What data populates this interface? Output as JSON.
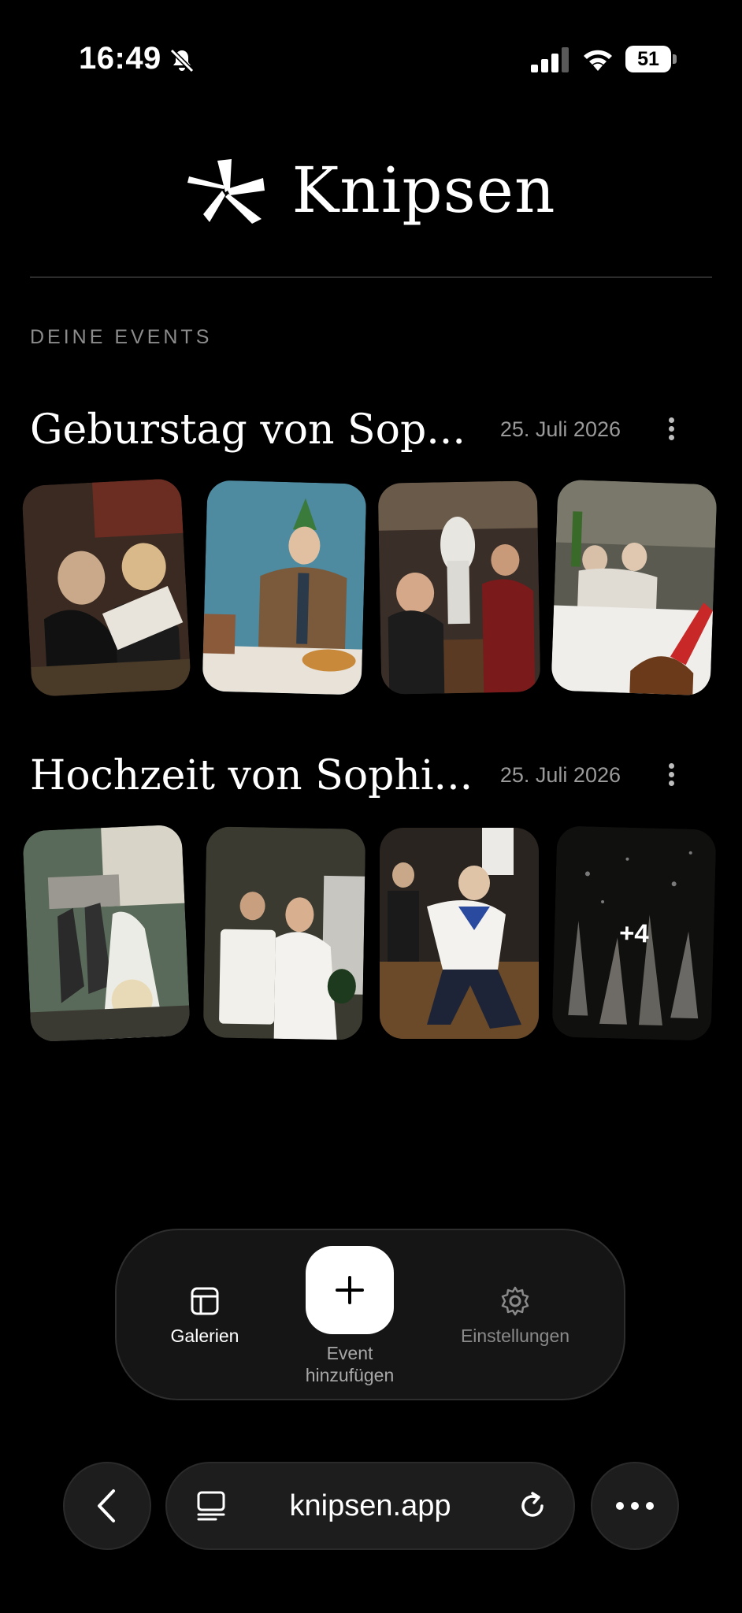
{
  "status_bar": {
    "time": "16:49",
    "battery": "51"
  },
  "brand": {
    "name": "Knipsen"
  },
  "section_label": "DEINE EVENTS",
  "events": [
    {
      "title": "Geburstag von Sop...",
      "date": "25. Juli 2026"
    },
    {
      "title": "Hochzeit von Sophi...",
      "date": "25. Juli 2026",
      "more_count": "+4"
    }
  ],
  "tabbar": {
    "galerien": "Galerien",
    "add_event_line1": "Event",
    "add_event_line2": "hinzufügen",
    "settings": "Einstellungen"
  },
  "browser": {
    "url": "knipsen.app"
  }
}
